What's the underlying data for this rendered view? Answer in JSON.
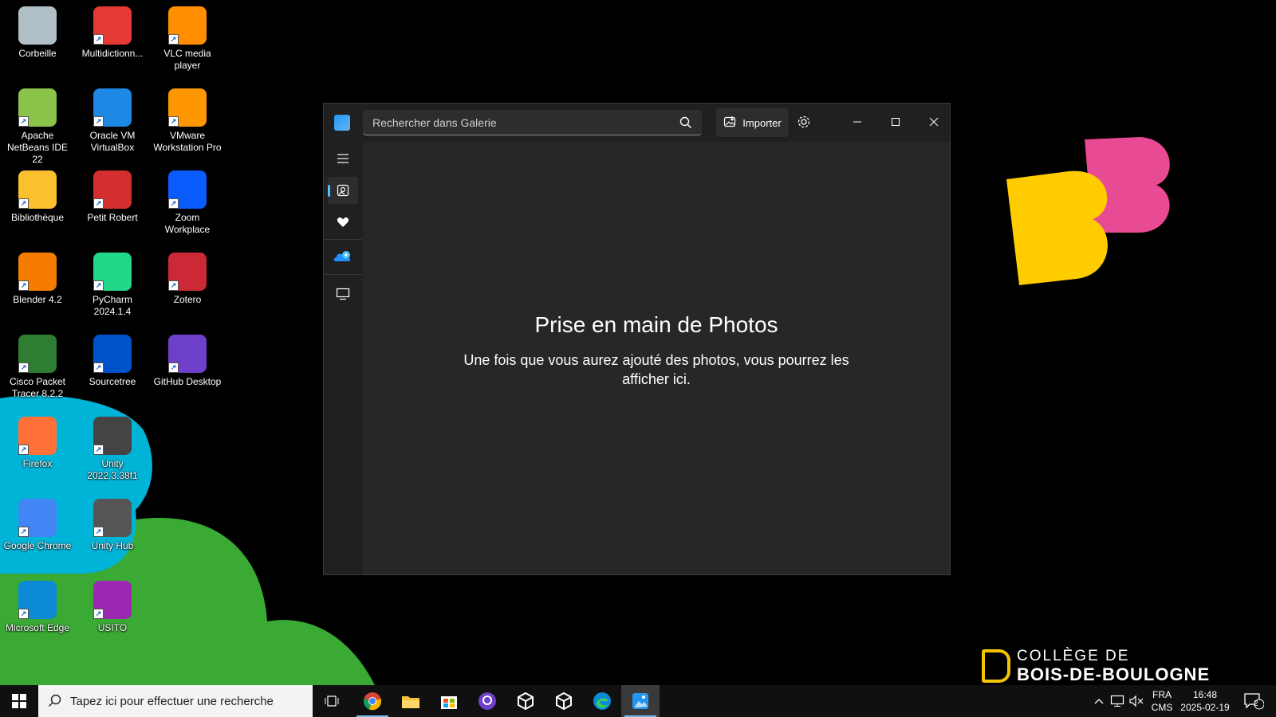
{
  "desktop": {
    "icons": [
      {
        "label": "Corbeille",
        "icon": "recycle-bin-icon",
        "color": "#b0bec5"
      },
      {
        "label": "Multidictionn...",
        "icon": "multidictionnaire-icon",
        "color": "#e53935"
      },
      {
        "label": "VLC media player",
        "icon": "vlc-icon",
        "color": "#ff8f00"
      },
      {
        "label": "Apache NetBeans IDE 22",
        "icon": "netbeans-icon",
        "color": "#8bc34a"
      },
      {
        "label": "Oracle VM VirtualBox",
        "icon": "virtualbox-icon",
        "color": "#1e88e5"
      },
      {
        "label": "VMware Workstation Pro",
        "icon": "vmware-icon",
        "color": "#ff9800"
      },
      {
        "label": "Bibliothèque",
        "icon": "library-icon",
        "color": "#fbc02d"
      },
      {
        "label": "Petit Robert",
        "icon": "petit-robert-icon",
        "color": "#d32f2f"
      },
      {
        "label": "Zoom Workplace",
        "icon": "zoom-icon",
        "color": "#0b5cff"
      },
      {
        "label": "Blender 4.2",
        "icon": "blender-icon",
        "color": "#f57c00"
      },
      {
        "label": "PyCharm 2024.1.4",
        "icon": "pycharm-icon",
        "color": "#21d789"
      },
      {
        "label": "Zotero",
        "icon": "zotero-icon",
        "color": "#cc2936"
      },
      {
        "label": "Cisco Packet Tracer 8.2.2",
        "icon": "packet-tracer-icon",
        "color": "#2e7d32"
      },
      {
        "label": "Sourcetree",
        "icon": "sourcetree-icon",
        "color": "#0052cc"
      },
      {
        "label": "GitHub Desktop",
        "icon": "github-desktop-icon",
        "color": "#6e40c9"
      },
      {
        "label": "Firefox",
        "icon": "firefox-icon",
        "color": "#ff7139"
      },
      {
        "label": "Unity 2022.3.38f1",
        "icon": "unity-icon",
        "color": "#444444"
      },
      {
        "label": "Google Chrome",
        "icon": "chrome-icon",
        "color": "#4285f4"
      },
      {
        "label": "Unity Hub",
        "icon": "unity-hub-icon",
        "color": "#555555"
      },
      {
        "label": "Microsoft Edge",
        "icon": "edge-icon",
        "color": "#0c8ad6"
      },
      {
        "label": "USITO",
        "icon": "usito-icon",
        "color": "#9c27b0"
      }
    ]
  },
  "photos_window": {
    "search_placeholder": "Rechercher dans Galerie",
    "import_label": "Importer",
    "empty_title": "Prise en main de Photos",
    "empty_text": "Une fois que vous aurez ajouté des photos, vous pourrez les afficher ici."
  },
  "brand": {
    "line1": "COLLÈGE DE",
    "line2": "BOIS-DE-BOULOGNE"
  },
  "taskbar": {
    "search_placeholder": "Tapez ici pour effectuer une recherche",
    "language_line1": "FRA",
    "language_line2": "CMS",
    "time": "16:48",
    "date": "2025-02-19",
    "notification_count": "2"
  }
}
